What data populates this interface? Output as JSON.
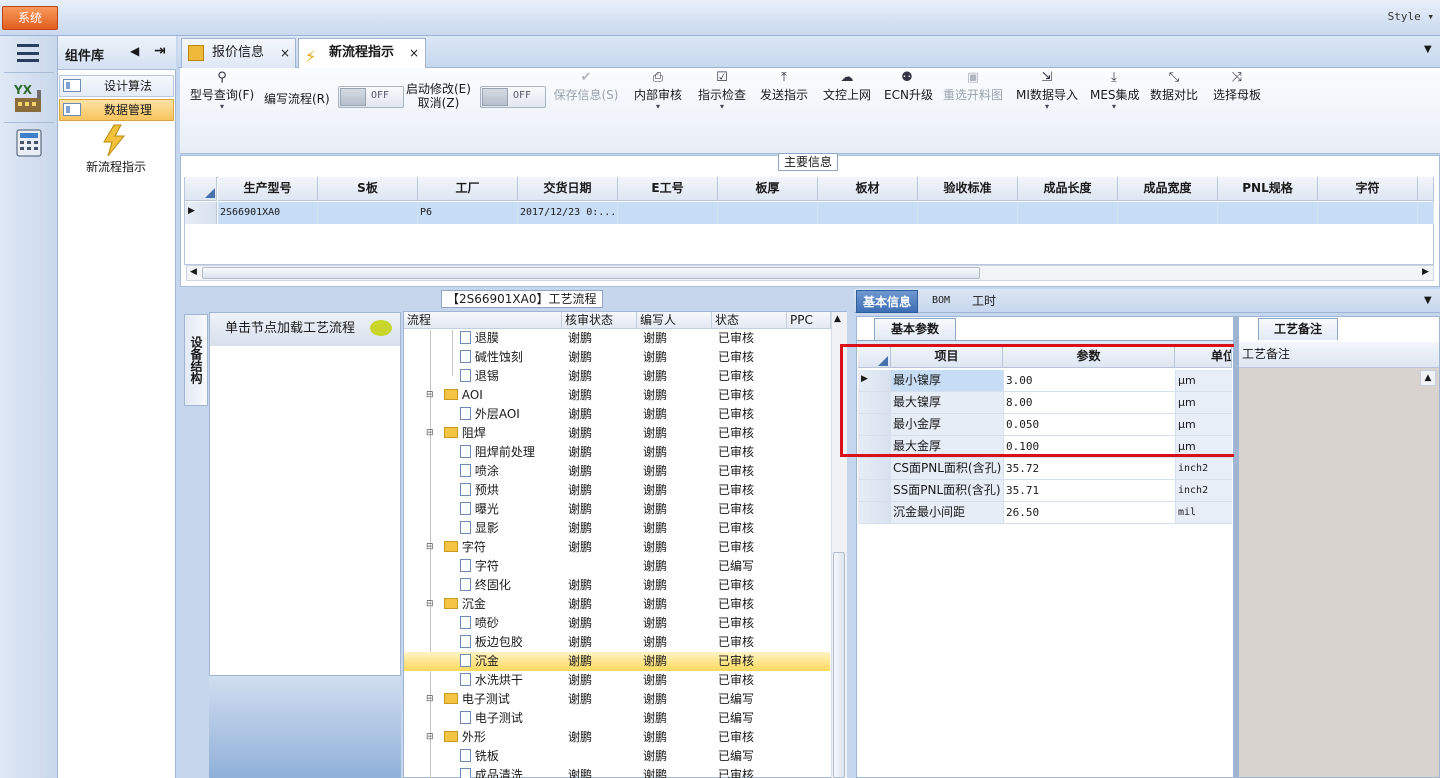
{
  "top": {
    "system_label": "系统",
    "style_label": "Style"
  },
  "library": {
    "title": "组件库",
    "items": [
      "设计算法",
      "数据管理"
    ],
    "big_item": "新流程指示"
  },
  "tabs": [
    {
      "label": "报价信息"
    },
    {
      "label": "新流程指示"
    }
  ],
  "toolbar": {
    "model_query": "型号查询(F)",
    "edit_flow": "编写流程(R)",
    "start_modify": "启动修改(E)",
    "cancel": "取消(Z)",
    "off": "OFF",
    "save": "保存信息(S)",
    "internal_review": "内部审核",
    "indication_check": "指示检查",
    "send_indication": "发送指示",
    "doc_upload": "文控上网",
    "ecn_upgrade": "ECN升级",
    "reselect_map": "重选开料图",
    "mi_import": "MI数据导入",
    "mes_integration": "MES集成",
    "data_compare": "数据对比",
    "select_panel": "选择母板"
  },
  "main_info": {
    "title": "主要信息",
    "columns": [
      "生产型号",
      "S板",
      "工厂",
      "交货日期",
      "E工号",
      "板厚",
      "板材",
      "验收标准",
      "成品长度",
      "成品宽度",
      "PNL规格",
      "字符"
    ],
    "row": [
      "2S66901XA0",
      "",
      "P6",
      "2017/12/23 0:...",
      "",
      "",
      "",
      "",
      "",
      "",
      "",
      ""
    ]
  },
  "process": {
    "title": "【2S66901XA0】工艺流程",
    "vertical_tab": "设备结构",
    "load_hint": "单击节点加载工艺流程",
    "columns": [
      "流程",
      "核审状态",
      "编写人",
      "状态",
      "PPC"
    ],
    "rows": [
      {
        "name": "退膜",
        "review": "谢鹏",
        "writer": "谢鹏",
        "status": "已审核"
      },
      {
        "name": "碱性蚀刻",
        "review": "谢鹏",
        "writer": "谢鹏",
        "status": "已审核"
      },
      {
        "name": "退锡",
        "review": "谢鹏",
        "writer": "谢鹏",
        "status": "已审核"
      },
      {
        "name": "AOI",
        "review": "谢鹏",
        "writer": "谢鹏",
        "status": "已审核"
      },
      {
        "name": "外层AOI",
        "review": "谢鹏",
        "writer": "谢鹏",
        "status": "已审核"
      },
      {
        "name": "阻焊",
        "review": "谢鹏",
        "writer": "谢鹏",
        "status": "已审核"
      },
      {
        "name": "阻焊前处理",
        "review": "谢鹏",
        "writer": "谢鹏",
        "status": "已审核"
      },
      {
        "name": "喷涂",
        "review": "谢鹏",
        "writer": "谢鹏",
        "status": "已审核"
      },
      {
        "name": "预烘",
        "review": "谢鹏",
        "writer": "谢鹏",
        "status": "已审核"
      },
      {
        "name": "曝光",
        "review": "谢鹏",
        "writer": "谢鹏",
        "status": "已审核"
      },
      {
        "name": "显影",
        "review": "谢鹏",
        "writer": "谢鹏",
        "status": "已审核"
      },
      {
        "name": "字符",
        "review": "谢鹏",
        "writer": "谢鹏",
        "status": "已审核"
      },
      {
        "name": "字符",
        "review": "",
        "writer": "谢鹏",
        "status": "已编写"
      },
      {
        "name": "终固化",
        "review": "谢鹏",
        "writer": "谢鹏",
        "status": "已审核"
      },
      {
        "name": "沉金",
        "review": "谢鹏",
        "writer": "谢鹏",
        "status": "已审核"
      },
      {
        "name": "喷砂",
        "review": "谢鹏",
        "writer": "谢鹏",
        "status": "已审核"
      },
      {
        "name": "板边包胶",
        "review": "谢鹏",
        "writer": "谢鹏",
        "status": "已审核"
      },
      {
        "name": "沉金",
        "review": "谢鹏",
        "writer": "谢鹏",
        "status": "已审核"
      },
      {
        "name": "水洗烘干",
        "review": "谢鹏",
        "writer": "谢鹏",
        "status": "已审核"
      },
      {
        "name": "电子测试",
        "review": "谢鹏",
        "writer": "谢鹏",
        "status": "已编写"
      },
      {
        "name": "电子测试",
        "review": "",
        "writer": "谢鹏",
        "status": "已编写"
      },
      {
        "name": "外形",
        "review": "谢鹏",
        "writer": "谢鹏",
        "status": "已审核"
      },
      {
        "name": "铣板",
        "review": "",
        "writer": "谢鹏",
        "status": "已编写"
      },
      {
        "name": "成品清洗",
        "review": "谢鹏",
        "writer": "谢鹏",
        "status": "已审核"
      }
    ]
  },
  "right_tabs": [
    "基本信息",
    "BOM",
    "工时"
  ],
  "params": {
    "subtab": "基本参数",
    "columns": [
      "项目",
      "参数",
      "单位"
    ],
    "rows": [
      {
        "item": "最小镍厚",
        "value": "3.00",
        "unit": "μm"
      },
      {
        "item": "最大镍厚",
        "value": "8.00",
        "unit": "μm"
      },
      {
        "item": "最小金厚",
        "value": "0.050",
        "unit": "μm"
      },
      {
        "item": "最大金厚",
        "value": "0.100",
        "unit": "μm"
      },
      {
        "item": "CS面PNL面积(含孔)",
        "value": "35.72",
        "unit": "inch2"
      },
      {
        "item": "SS面PNL面积(含孔)",
        "value": "35.71",
        "unit": "inch2"
      },
      {
        "item": "沉金最小间距",
        "value": "26.50",
        "unit": "mil"
      }
    ]
  },
  "notes": {
    "subtab": "工艺备注",
    "header": "工艺备注"
  }
}
